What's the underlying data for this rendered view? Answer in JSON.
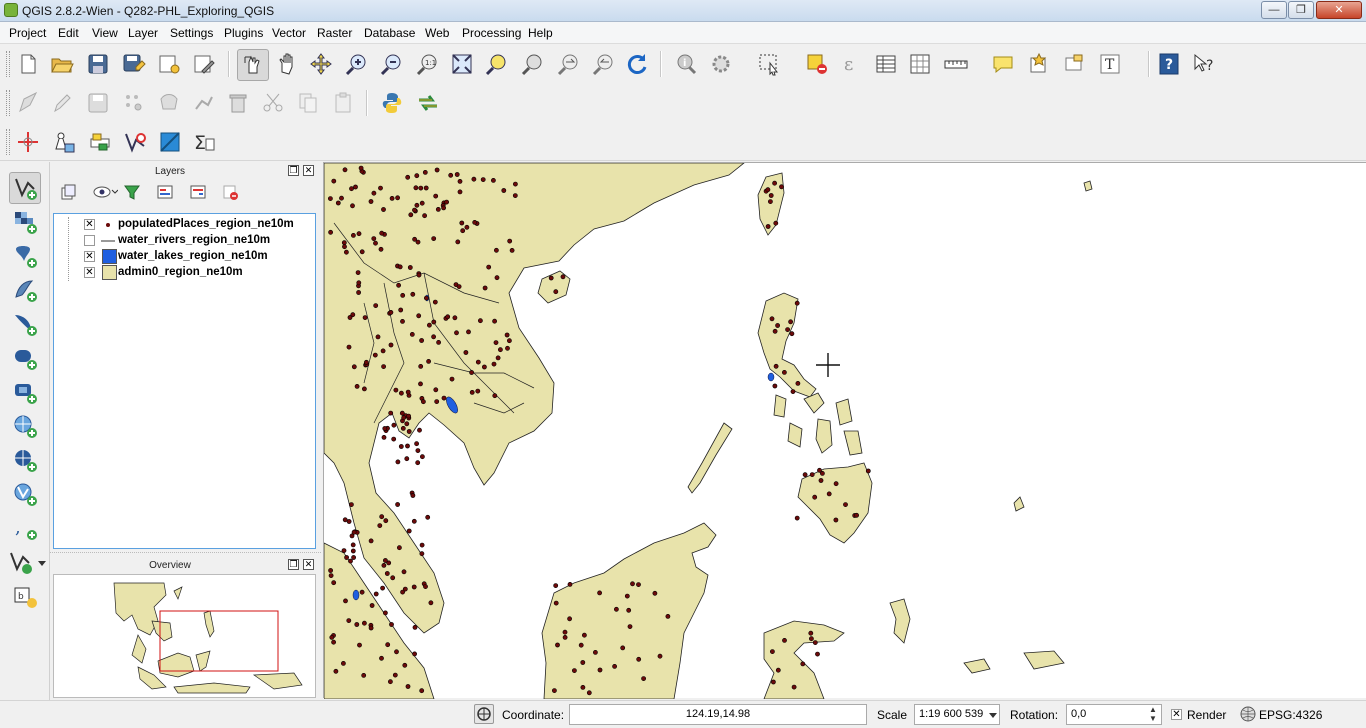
{
  "window": {
    "title": "QGIS 2.8.2-Wien - Q282-PHL_Exploring_QGIS",
    "minimize": "—",
    "maximize": "❐",
    "close": "✕"
  },
  "menu": [
    "Project",
    "Edit",
    "View",
    "Layer",
    "Settings",
    "Plugins",
    "Vector",
    "Raster",
    "Database",
    "Web",
    "Processing",
    "Help"
  ],
  "panels": {
    "layers_title": "Layers",
    "overview_title": "Overview"
  },
  "layers": [
    {
      "name": "populatedPlaces_region_ne10m",
      "checked": true,
      "symbol": "point"
    },
    {
      "name": "water_rivers_region_ne10m",
      "checked": false,
      "symbol": "line"
    },
    {
      "name": "water_lakes_region_ne10m",
      "checked": true,
      "symbol": "fill-blue"
    },
    {
      "name": "admin0_region_ne10m",
      "checked": true,
      "symbol": "fill-land"
    }
  ],
  "statusbar": {
    "coordinate_label": "Coordinate:",
    "coordinate_value": "124.19,14.98",
    "scale_label": "Scale",
    "scale_value": "1:19 600 539",
    "rotation_label": "Rotation:",
    "rotation_value": "0,0",
    "render_label": "Render",
    "render_checked": true,
    "crs": "EPSG:4326"
  },
  "colors": {
    "land": "#e8e3ab",
    "lake": "#1f5fe0",
    "point_fill": "#6b0a0a",
    "overview_extent": "#d01010"
  }
}
